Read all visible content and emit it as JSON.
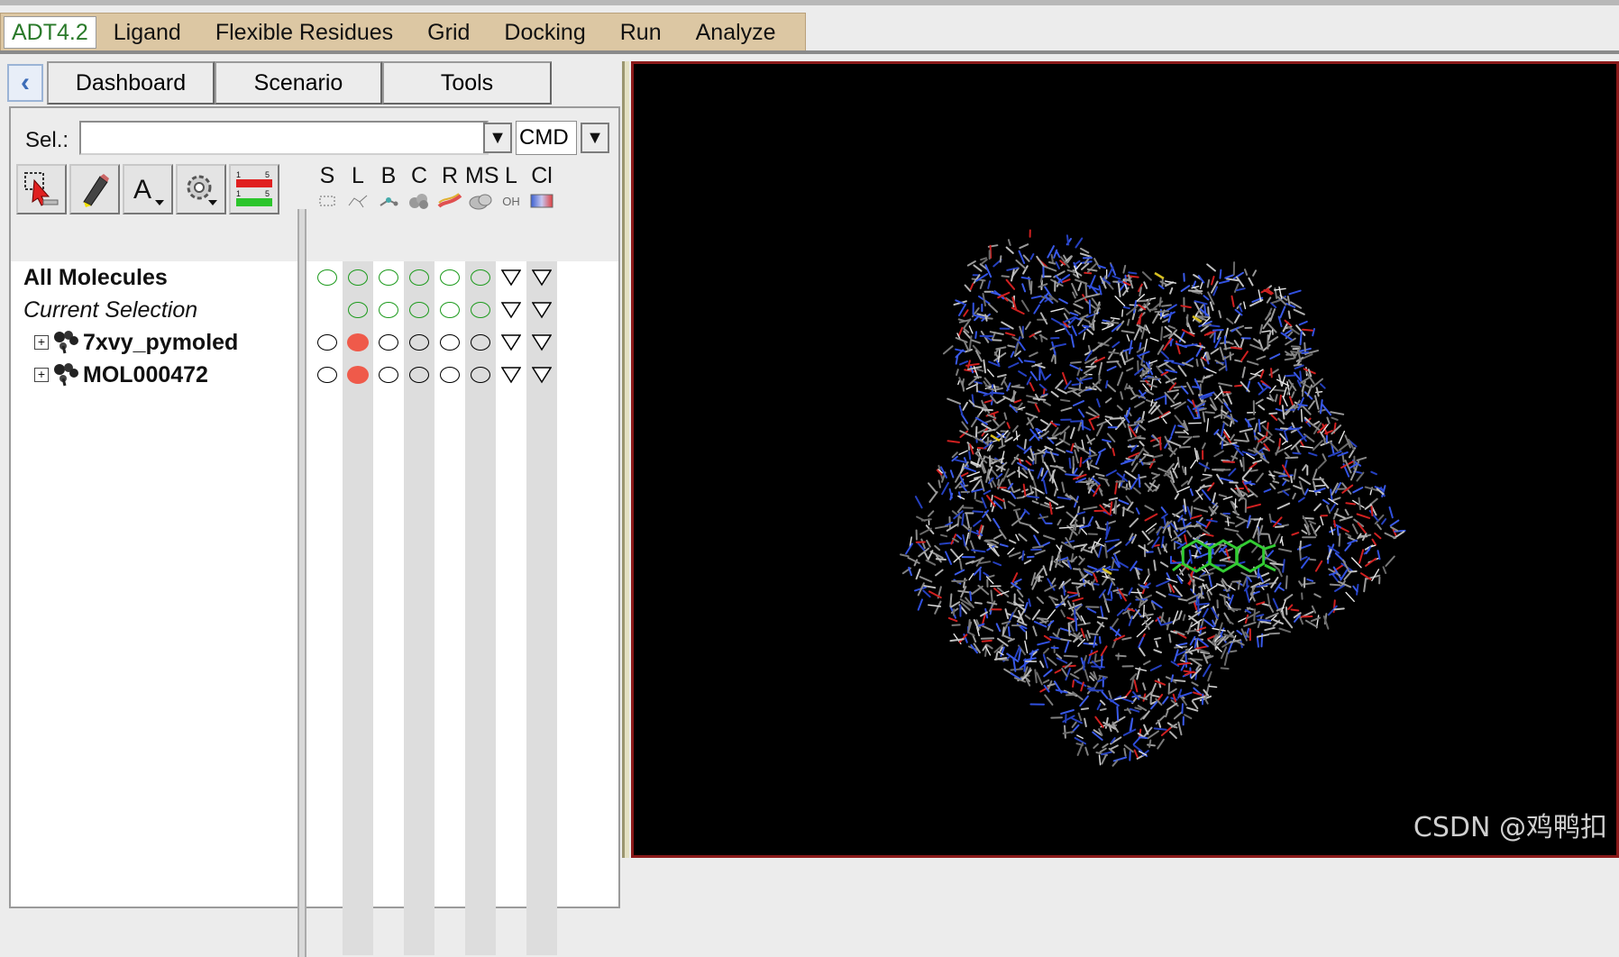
{
  "menubar": {
    "items": [
      "ADT4.2",
      "Ligand",
      "Flexible Residues",
      "Grid",
      "Docking",
      "Run",
      "Analyze"
    ]
  },
  "dashboard": {
    "tabs": [
      "Dashboard",
      "Scenario",
      "Tools"
    ],
    "selection_label": "Sel.:",
    "selection_value": "",
    "command_mode": "CMD",
    "columns": [
      {
        "letter": "S",
        "icon": "select-box-icon"
      },
      {
        "letter": "L",
        "icon": "lines-icon"
      },
      {
        "letter": "B",
        "icon": "ball-stick-icon"
      },
      {
        "letter": "C",
        "icon": "cpk-icon"
      },
      {
        "letter": "R",
        "icon": "ribbon-icon"
      },
      {
        "letter": "MS",
        "icon": "surface-icon"
      },
      {
        "letter": "L",
        "icon": "label-icon",
        "mini_text": "OH"
      },
      {
        "letter": "Cl",
        "icon": "color-icon"
      }
    ],
    "tree": [
      {
        "label": "All Molecules",
        "style": "bold",
        "expandable": false
      },
      {
        "label": "Current Selection",
        "style": "italic",
        "expandable": false
      },
      {
        "label": "7xvy_pymoled",
        "style": "bold",
        "expandable": true
      },
      {
        "label": "MOL000472",
        "style": "bold",
        "expandable": true
      }
    ]
  },
  "viewer": {
    "watermark": "CSDN @鸡鸭扣",
    "colors": {
      "background": "#000000",
      "frame": "#8b1a1a",
      "ligand": "#33cc33"
    }
  }
}
